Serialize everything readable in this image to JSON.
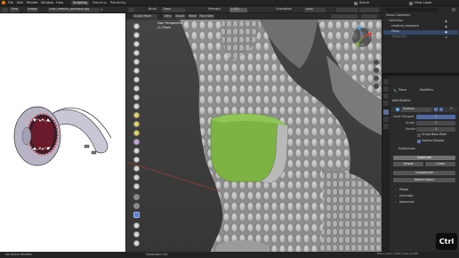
{
  "topbar": {
    "menus": [
      "File",
      "Edit",
      "Render",
      "Window",
      "Help"
    ],
    "workspaces": [
      "Sculpting",
      "Texturing",
      "Rendering"
    ],
    "active_workspace": "Sculpting",
    "scene": "Scene",
    "view_layer": "View Layer"
  },
  "image_editor": {
    "header": [
      "View",
      "Image"
    ],
    "filename": "cute_creature_backpack.jpg"
  },
  "viewport": {
    "mode": "Sculpt Mode",
    "menus": [
      "View",
      "Sculpt",
      "Mask",
      "Face Sets"
    ],
    "brush_label": "Brush",
    "brush": "Draw",
    "strength_label": "Strength",
    "strength_value": "1.000",
    "orientation_label": "Orientation",
    "orientation_value": "Local",
    "overlay_label": "User Perspective",
    "object_label": "(1) Plane",
    "axis_labels": [
      "X",
      "Y",
      "Z"
    ]
  },
  "outliner": {
    "title": "Scene Collection",
    "rows": [
      "Collection",
      "creature_backpack",
      "Plane",
      "Plane.001"
    ]
  },
  "properties": {
    "object_name": "Plane",
    "modifier_tab": "Modifiers",
    "add_modifier": "Add Modifier",
    "modifier_name": "Multires",
    "levels_viewport_label": "Level Viewport",
    "levels_viewport_value": "1",
    "sculpt_label": "Sculpt",
    "sculpt_value": "1",
    "render_label": "Render",
    "render_value": "1",
    "sculpt_base_mesh": "Sculpt Base Mesh",
    "optimal_display": "Optimal Display",
    "subdivision_section": "Subdivision",
    "subdivide": "Subdivide",
    "simple": "Simple",
    "linear": "Linear",
    "unsubdivide": "Unsubdivide",
    "delete_higher": "Delete Higher",
    "shape_section": "Shape",
    "generate_section": "Generate",
    "advanced_section": "Advanced"
  },
  "status": {
    "left": "Set Active Modifier",
    "middle": "Subdivision Set",
    "right": "Plane | Verts: 2,298 | Faces: 12,288"
  },
  "key_overlay": "Ctrl",
  "colors": {
    "green_patch": "#7cb342",
    "sculpt_clay": "#a4a4a4",
    "selection": "#34476b"
  }
}
